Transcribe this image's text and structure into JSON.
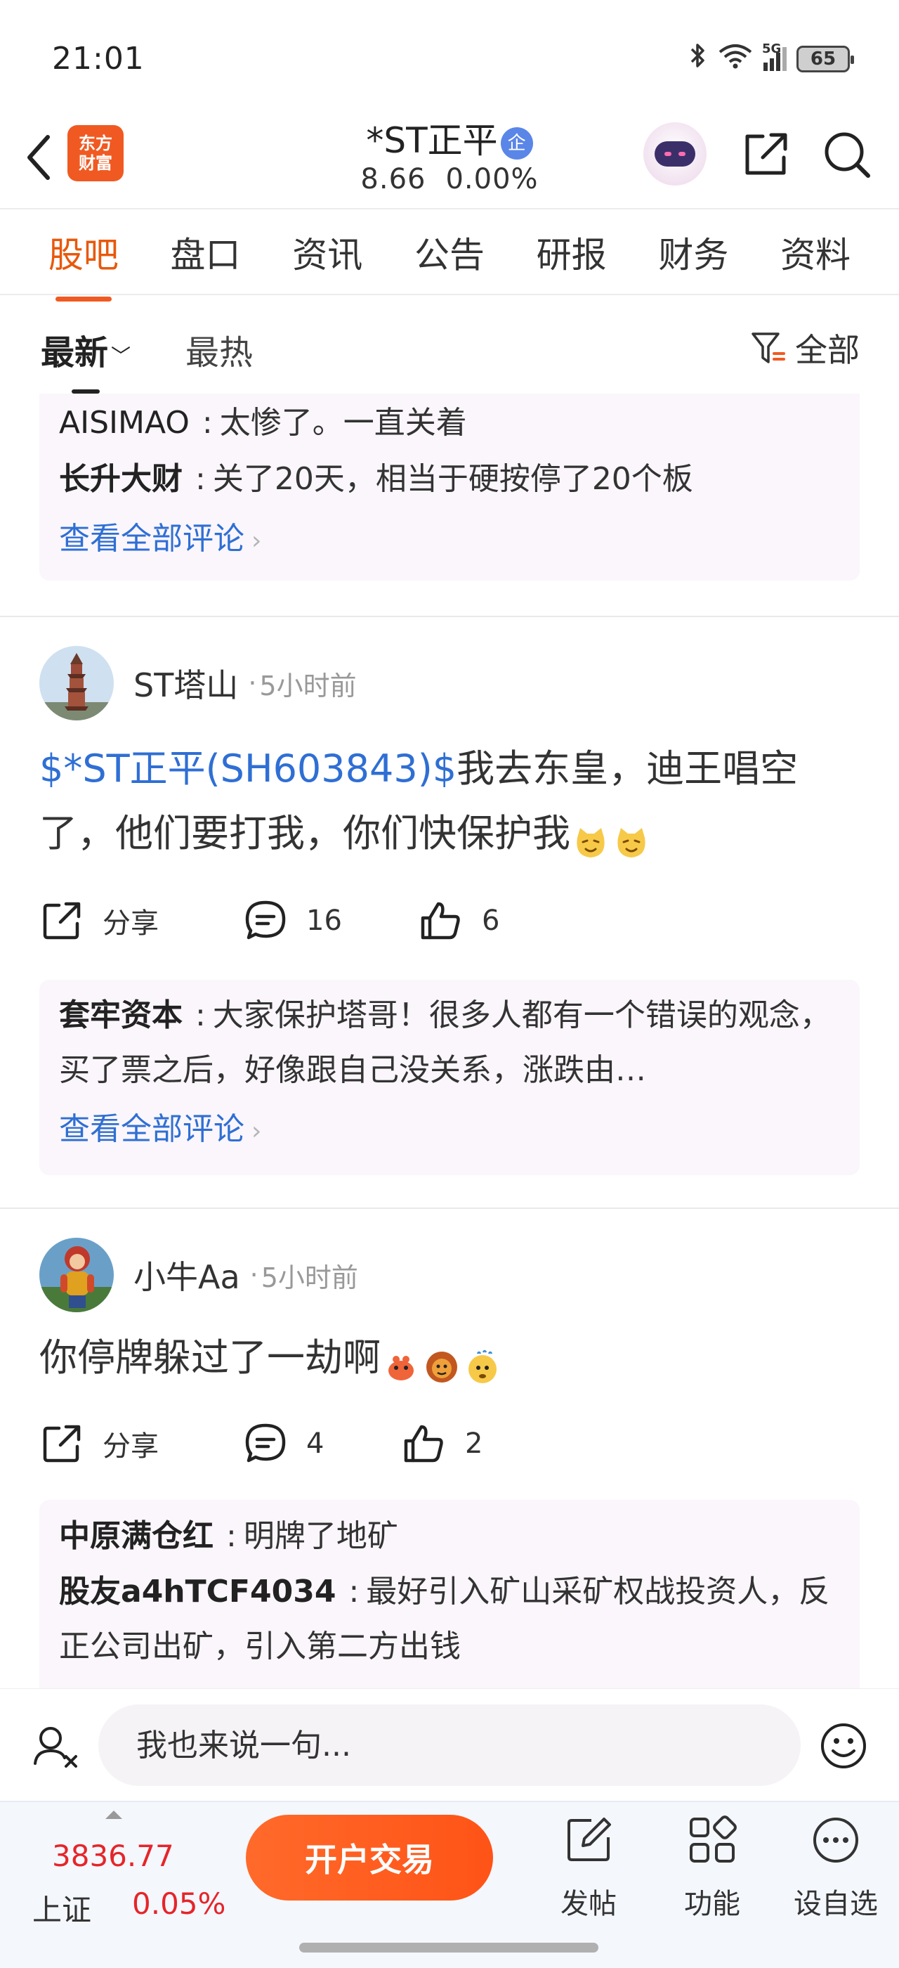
{
  "status_bar": {
    "time": "21:01",
    "network": "5G",
    "battery": "65"
  },
  "header": {
    "app_logo_line1": "东方",
    "app_logo_line2": "财富",
    "stock_name": "*ST正平",
    "verified_badge": "企",
    "price": "8.66",
    "change": "0.00%"
  },
  "main_tabs": [
    "股吧",
    "盘口",
    "资讯",
    "公告",
    "研报",
    "财务",
    "资料"
  ],
  "sort": {
    "newest": "最新",
    "hot": "最热",
    "filter": "全部"
  },
  "feed": {
    "top_comments": [
      {
        "author": "AISIMAO",
        "text": "太惨了。一直关着"
      },
      {
        "author": "长升大财",
        "text": "关了20天，相当于硬按停了20个板"
      }
    ],
    "view_all": "查看全部评论",
    "posts": [
      {
        "user": "ST塔山",
        "time": "5小时前",
        "stock_tag": "$*ST正平(SH603843)$",
        "text": "我去东皇，迪王唱空了，他们要打我，你们快保护我",
        "share": "分享",
        "comments": "16",
        "likes": "6",
        "replies": [
          {
            "author": "套牢资本",
            "text": "大家保护塔哥！很多人都有一个错误的观念，买了票之后，好像跟自己没关系，涨跌由…"
          }
        ]
      },
      {
        "user": "小牛Aa",
        "time": "5小时前",
        "text": "你停牌躲过了一劫啊",
        "share": "分享",
        "comments": "4",
        "likes": "2",
        "replies": [
          {
            "author": "中原满仓红",
            "text": "明牌了地矿"
          },
          {
            "author": "股友a4hTCF4034",
            "text": "最好引入矿山采矿权战投资人，反正公司出矿，引入第二方出钱"
          }
        ]
      }
    ]
  },
  "reply_bar": {
    "placeholder": "我也来说一句..."
  },
  "bottom_bar": {
    "index_value": "3836.77",
    "index_name": "上证",
    "index_change": "0.05%",
    "trade_button": "开户交易",
    "post_label": "发帖",
    "function_label": "功能",
    "watchlist_label": "设自选"
  },
  "colors": {
    "accent": "#f05a22",
    "link": "#2f6fd4",
    "up": "#e5252a"
  }
}
